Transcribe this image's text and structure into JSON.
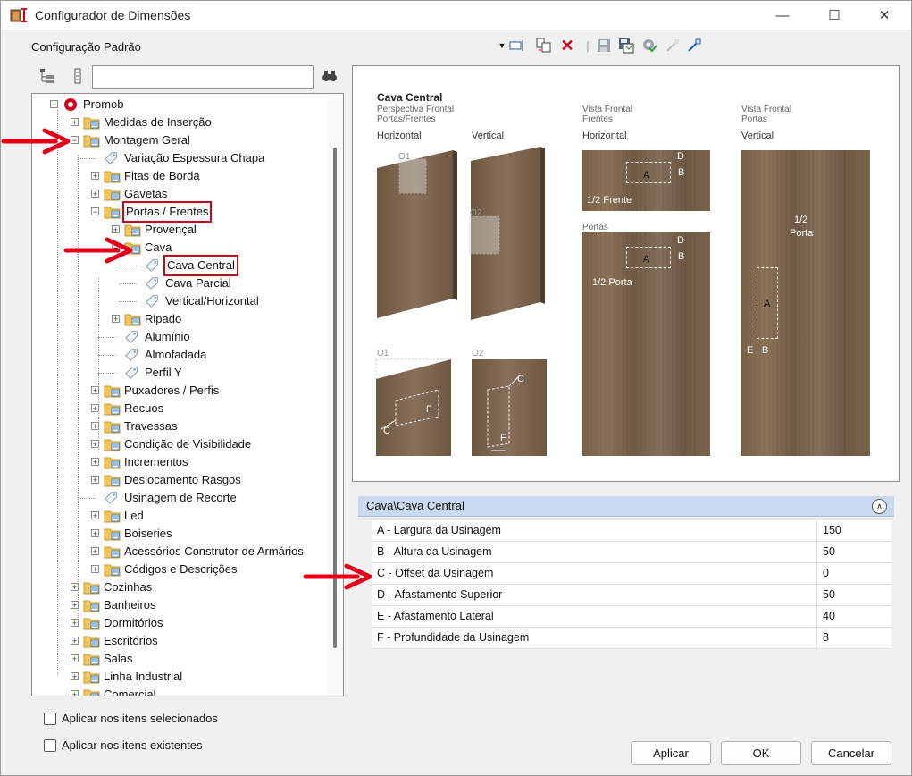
{
  "window": {
    "title": "Configurador de Dimensões"
  },
  "toolbar": {
    "config_name": "Configuração Padrão"
  },
  "tree": {
    "items": [
      "Promob",
      "Medidas de Inserção",
      "Montagem Geral",
      "Variação Espessura Chapa",
      "Fitas de Borda",
      "Gavetas",
      "Portas / Frentes",
      "Provençal",
      "Cava",
      "Cava Central",
      "Cava Parcial",
      "Vertical/Horizontal",
      "Ripado",
      "Alumínio",
      "Almofadada",
      "Perfil Y",
      "Puxadores / Perfis",
      "Recuos",
      "Travessas",
      "Condição de Visibilidade",
      "Incrementos",
      "Deslocamento Rasgos",
      "Usinagem de Recorte",
      "Led",
      "Boiseries",
      "Acessórios Construtor de Armários",
      "Códigos e Descrições",
      "Cozinhas",
      "Banheiros",
      "Dormitórios",
      "Escritórios",
      "Salas",
      "Linha Industrial",
      "Comercial"
    ]
  },
  "preview": {
    "title": "Cava Central",
    "col1_caption1": "Perspectiva Frontal",
    "col1_caption2": "Portas/Frentes",
    "col3_caption1": "Vista Frontal",
    "col3_caption2": "Frentes",
    "col4_caption1": "Vista Frontal",
    "col4_caption2": "Portas",
    "horizontal": "Horizontal",
    "vertical": "Vertical",
    "o1": "O1",
    "o2": "O2",
    "portas_label": "Portas",
    "half_frente": "1/2 Frente",
    "half_porta": "1/2 Porta",
    "half": "1/2",
    "porta": "Porta",
    "a": "A",
    "b": "B",
    "c": "C",
    "d": "D",
    "e": "E",
    "f": "F"
  },
  "properties": {
    "header": "Cava\\Cava Central",
    "rows": [
      {
        "label": "A - Largura da Usinagem",
        "value": "150"
      },
      {
        "label": "B - Altura da Usinagem",
        "value": "50"
      },
      {
        "label": "C - Offset da Usinagem",
        "value": "0"
      },
      {
        "label": "D - Afastamento Superior",
        "value": "50"
      },
      {
        "label": "E - Afastamento Lateral",
        "value": "40"
      },
      {
        "label": "F - Profundidade da Usinagem",
        "value": "8"
      }
    ]
  },
  "options": {
    "apply_selected": "Aplicar nos itens selecionados",
    "apply_existing": "Aplicar nos itens existentes"
  },
  "buttons": {
    "apply": "Aplicar",
    "ok": "OK",
    "cancel": "Cancelar"
  },
  "colors": {
    "accent_red": "#d0021b",
    "header_blue": "#c9daf0",
    "wood": "#7a6249"
  }
}
